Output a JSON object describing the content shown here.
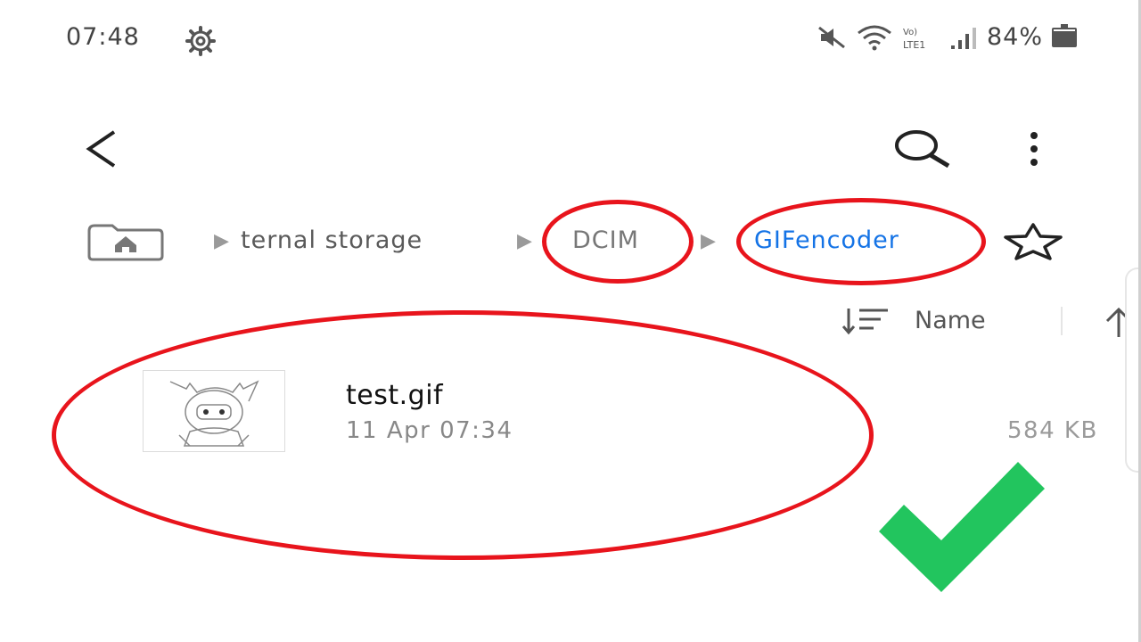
{
  "status_bar": {
    "time": "07:48",
    "battery_percent": "84%",
    "icons": [
      "gear-icon",
      "mute-icon",
      "wifi-icon",
      "lte-icon",
      "signal-icon",
      "battery-icon"
    ]
  },
  "toolbar": {
    "icons": [
      "back-icon",
      "search-icon",
      "more-vert-icon"
    ]
  },
  "breadcrumb": {
    "items": [
      "ternal storage",
      "DCIM",
      "GIFencoder"
    ],
    "separator": "▶",
    "active_color": "#1473e6"
  },
  "sort": {
    "label": "Name"
  },
  "files": [
    {
      "name": "test.gif",
      "date": "11 Apr 07:34",
      "size": "584 KB"
    }
  ],
  "annotations": {
    "circle_color": "#e8141c",
    "check_color": "#22c55e"
  }
}
